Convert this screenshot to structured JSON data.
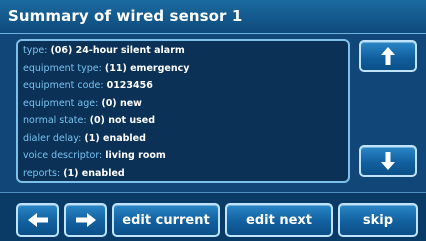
{
  "title": "Summary of wired sensor 1",
  "rows": [
    {
      "key": "type:",
      "value": "(06) 24-hour silent alarm"
    },
    {
      "key": "equipment type:",
      "value": "(11) emergency"
    },
    {
      "key": "equipment code:",
      "value": "0123456"
    },
    {
      "key": "equipment age:",
      "value": "(0) new"
    },
    {
      "key": "normal state:",
      "value": "(0) not used"
    },
    {
      "key": "dialer delay:",
      "value": "(1) enabled"
    },
    {
      "key": "voice descriptor:",
      "value": "living room"
    },
    {
      "key": "reports:",
      "value": "(1) enabled"
    }
  ],
  "buttons": {
    "edit_current": "edit current",
    "edit_next": "edit next",
    "skip": "skip"
  },
  "icons": {
    "scroll_up": "arrow-up-icon",
    "scroll_down": "arrow-down-icon",
    "back": "arrow-left-icon",
    "forward": "arrow-right-icon"
  },
  "colors": {
    "background": "#0d3f6e",
    "label": "#78c2f2",
    "value": "#ffffff",
    "button_border": "#bfe3fa"
  }
}
